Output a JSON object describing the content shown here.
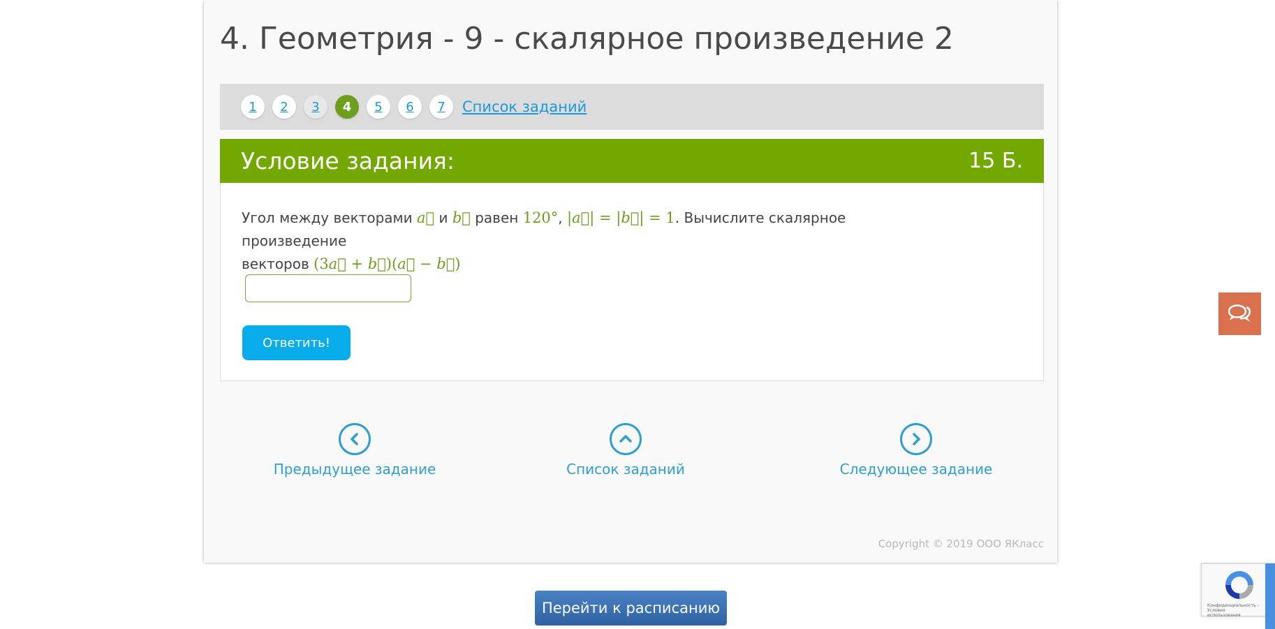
{
  "page": {
    "title": "4. Геометрия - 9 - скалярное произведение 2"
  },
  "task_nav": {
    "items": [
      {
        "label": "1",
        "state": "default"
      },
      {
        "label": "2",
        "state": "default"
      },
      {
        "label": "3",
        "state": "done"
      },
      {
        "label": "4",
        "state": "active"
      },
      {
        "label": "5",
        "state": "default"
      },
      {
        "label": "6",
        "state": "default"
      },
      {
        "label": "7",
        "state": "default"
      }
    ],
    "list_link": "Список заданий"
  },
  "task": {
    "header": "Условие задания:",
    "score": "15 Б.",
    "text_part1": "Угол между векторами",
    "text_and": "и",
    "text_part2": "равен",
    "angle": "120°",
    "text_part3": ". Вычислите скалярное произведение",
    "text_part4": "векторов",
    "answer_value": "",
    "submit_label": "Ответить!"
  },
  "bottom_nav": {
    "prev": "Предыдущее задание",
    "list": "Список заданий",
    "next": "Следующее задание"
  },
  "footer": {
    "copyright": "Copyright © 2019 ООО ЯКласс"
  },
  "schedule_button": "Перейти к расписанию",
  "recaptcha": {
    "text": "Конфиденциальность - Условия использования"
  },
  "colors": {
    "accent_green": "#73a800",
    "link_blue": "#1a9ad6",
    "button_blue": "#08aceb",
    "chat_orange": "#d9714e"
  },
  "icons": {
    "prev": "chevron-left-icon",
    "list": "chevron-up-icon",
    "next": "chevron-right-icon",
    "chat": "chat-icon"
  }
}
